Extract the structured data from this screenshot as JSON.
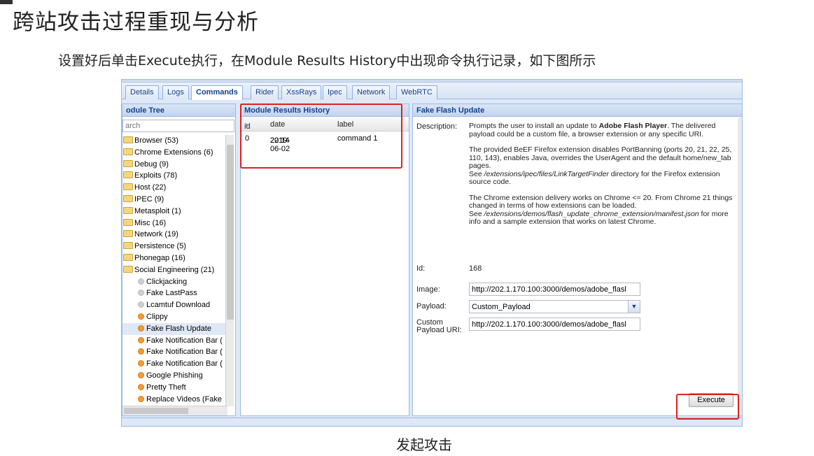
{
  "slide": {
    "title": "跨站攻击过程重现与分析",
    "caption": "设置好后单击Execute执行，在Module Results History中出现命令执行记录，如下图所示",
    "figure_caption": "发起攻击"
  },
  "tabs": [
    "Details",
    "Logs",
    "Commands",
    "Rider",
    "XssRays",
    "Ipec",
    "Network",
    "WebRTC"
  ],
  "active_tab": "Commands",
  "module_tree": {
    "header": "odule Tree",
    "search_placeholder": "arch",
    "folders": [
      "Browser (53)",
      "Chrome Extensions (6)",
      "Debug (9)",
      "Exploits (78)",
      "Host (22)",
      "IPEC (9)",
      "Metasploit (1)",
      "Misc (16)",
      "Network (19)",
      "Persistence (5)",
      "Phonegap (16)",
      "Social Engineering (21)"
    ],
    "modules": [
      {
        "label": "Clickjacking",
        "status": "grey"
      },
      {
        "label": "Fake LastPass",
        "status": "grey"
      },
      {
        "label": "Lcamtuf Download",
        "status": "grey"
      },
      {
        "label": "Clippy",
        "status": "orange"
      },
      {
        "label": "Fake Flash Update",
        "status": "orange"
      },
      {
        "label": "Fake Notification Bar (",
        "status": "orange"
      },
      {
        "label": "Fake Notification Bar (",
        "status": "orange"
      },
      {
        "label": "Fake Notification Bar (",
        "status": "orange"
      },
      {
        "label": "Google Phishing",
        "status": "orange"
      },
      {
        "label": "Pretty Theft",
        "status": "orange"
      },
      {
        "label": "Replace Videos (Fake",
        "status": "orange"
      }
    ]
  },
  "history": {
    "header": "Module Results History",
    "columns": [
      "id",
      "date",
      "label"
    ],
    "sort_indicator": "▲",
    "rows": [
      {
        "id": "0",
        "date_line1": "2019-06-02",
        "date_line2": "22:14",
        "label": "command 1"
      }
    ]
  },
  "detail": {
    "header": "Fake Flash Update",
    "description_label": "Description:",
    "desc_p1_before": "Prompts the user to install an update to ",
    "desc_p1_bold": "Adobe Flash Player",
    "desc_p1_after": ". The delivered payload could be a custom file, a browser extension or any specific URI.",
    "desc_p2": "The provided BeEF Firefox extension disables PortBanning (ports 20, 21, 22, 25, 110, 143), enables Java, overrides the UserAgent and the default home/new_tab pages.",
    "desc_p2b_before": "See ",
    "desc_p2b_italic": "/extensions/ipec/files/LinkTargetFinder",
    "desc_p2b_after": " directory for the Firefox extension source code.",
    "desc_p3": "The Chrome extension delivery works on Chrome <= 20. From Chrome 21 things changed in terms of how extensions can be loaded.",
    "desc_p3b_before": "See ",
    "desc_p3b_italic": "/extensions/demos/flash_update_chrome_extension/manifest.json",
    "desc_p3b_after": " for more info and a sample extension that works on latest Chrome.",
    "id_label": "Id:",
    "id_value": "168",
    "image_label": "Image:",
    "image_value": "http://202.1.170.100:3000/demos/adobe_flasl",
    "payload_label": "Payload:",
    "payload_value": "Custom_Payload",
    "custom_label_1": "Custom",
    "custom_label_2": "Payload URI:",
    "custom_value": "http://202.1.170.100:3000/demos/adobe_flasl",
    "execute_label": "Execute"
  }
}
